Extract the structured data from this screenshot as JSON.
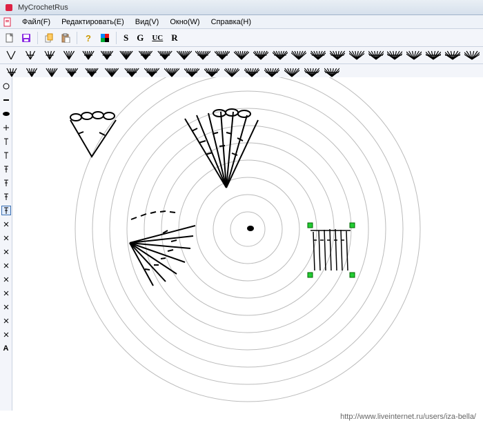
{
  "window": {
    "title": "MyCrochetRus"
  },
  "menu": {
    "file": "Файл(F)",
    "edit": "Редактировать(E)",
    "view": "Вид(V)",
    "window": "Окно(W)",
    "help": "Справка(H)"
  },
  "toolbar": {
    "new_icon": "new",
    "save_icon": "save",
    "copy_icon": "copy",
    "paste_icon": "paste",
    "help_icon": "help",
    "palette_icon": "palette",
    "s_label": "S",
    "g_label": "G",
    "uc_label": "UC",
    "r_label": "R"
  },
  "symbol_rows": {
    "row1_count": 25,
    "row2_count": 17
  },
  "vertical_tools": {
    "items": [
      "circle",
      "dash",
      "oval",
      "plus",
      "t1",
      "t2",
      "t3",
      "t4",
      "t5",
      "t6",
      "x1",
      "x2",
      "x3",
      "x4",
      "x5",
      "x6",
      "x7",
      "x8",
      "x9",
      "a"
    ],
    "selected_index": 9,
    "a_label": "A"
  },
  "canvas": {
    "circle_count": 10,
    "selection_handles": 4
  },
  "footer": {
    "url": "http://www.liveinternet.ru/users/iza-bella/"
  }
}
